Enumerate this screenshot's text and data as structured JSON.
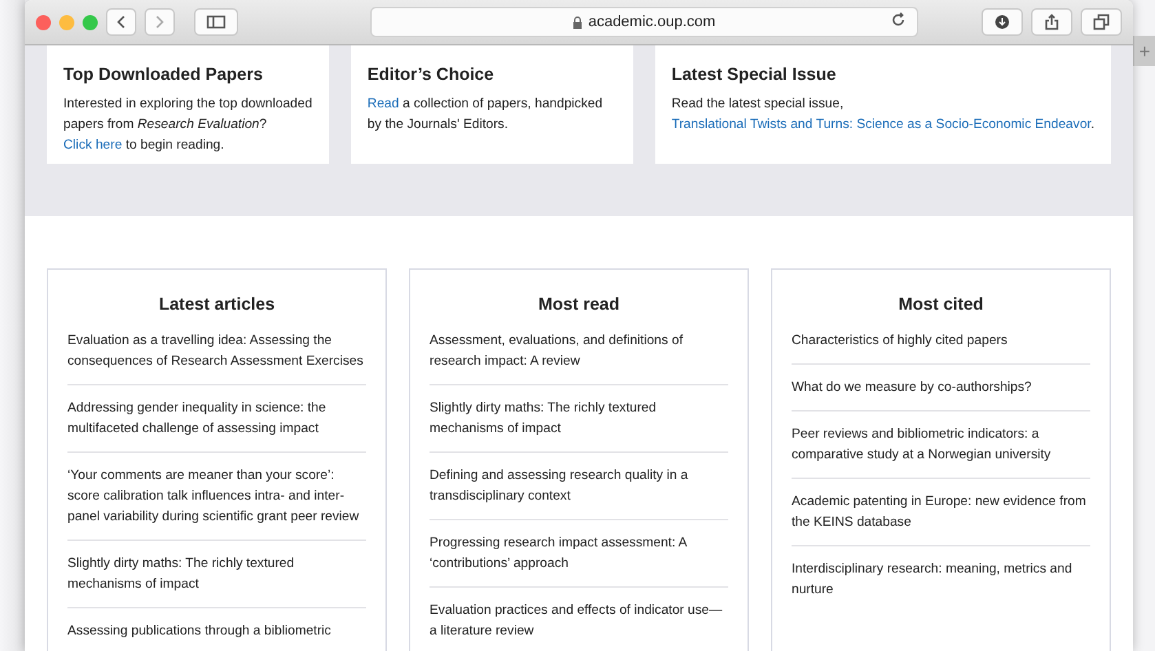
{
  "browser": {
    "url": "academic.oup.com",
    "new_tab": "+"
  },
  "featured": [
    {
      "title": "Top Downloaded Papers",
      "body": [
        {
          "kind": "text",
          "text": "Interested in exploring the top downloaded papers from "
        },
        {
          "kind": "italic",
          "text": "Research Evaluation"
        },
        {
          "kind": "text",
          "text": "? "
        },
        {
          "kind": "link",
          "text": "Click here"
        },
        {
          "kind": "text",
          "text": " to begin reading."
        }
      ]
    },
    {
      "title": "Editor’s Choice",
      "body": [
        {
          "kind": "link",
          "text": "Read"
        },
        {
          "kind": "text",
          "text": " a collection of papers, handpicked by the Journals' Editors."
        }
      ]
    },
    {
      "title": "Latest Special Issue",
      "body": [
        {
          "kind": "text",
          "text": "Read the latest special issue, "
        },
        {
          "kind": "link",
          "text": "Translational Twists and Turns: Science as a Socio-Economic Endeavor"
        },
        {
          "kind": "text",
          "text": "."
        }
      ]
    }
  ],
  "lists": [
    {
      "title": "Latest articles",
      "items": [
        "Evaluation as a travelling idea: Assessing the consequences of Research Assessment Exercises",
        "Addressing gender inequality in science: the multifaceted challenge of assessing impact",
        "‘Your comments are meaner than your score’: score calibration talk influences intra- and inter-panel variability during scientific grant peer review",
        "Slightly dirty maths: The richly textured mechanisms of impact",
        "Assessing publications through a bibliometric"
      ]
    },
    {
      "title": "Most read",
      "items": [
        "Assessment, evaluations, and definitions of research impact: A review",
        "Slightly dirty maths: The richly textured mechanisms of impact",
        "Defining and assessing research quality in a transdisciplinary context",
        "Progressing research impact assessment: A ‘contributions’ approach",
        "Evaluation practices and effects of indicator use—a literature review"
      ]
    },
    {
      "title": "Most cited",
      "items": [
        "Characteristics of highly cited papers",
        "What do we measure by co-authorships?",
        "Peer reviews and bibliometric indicators: a comparative study at a Norwegian university",
        "Academic patenting in Europe: new evidence from the KEINS database",
        "Interdisciplinary research: meaning, metrics and nurture"
      ]
    }
  ]
}
